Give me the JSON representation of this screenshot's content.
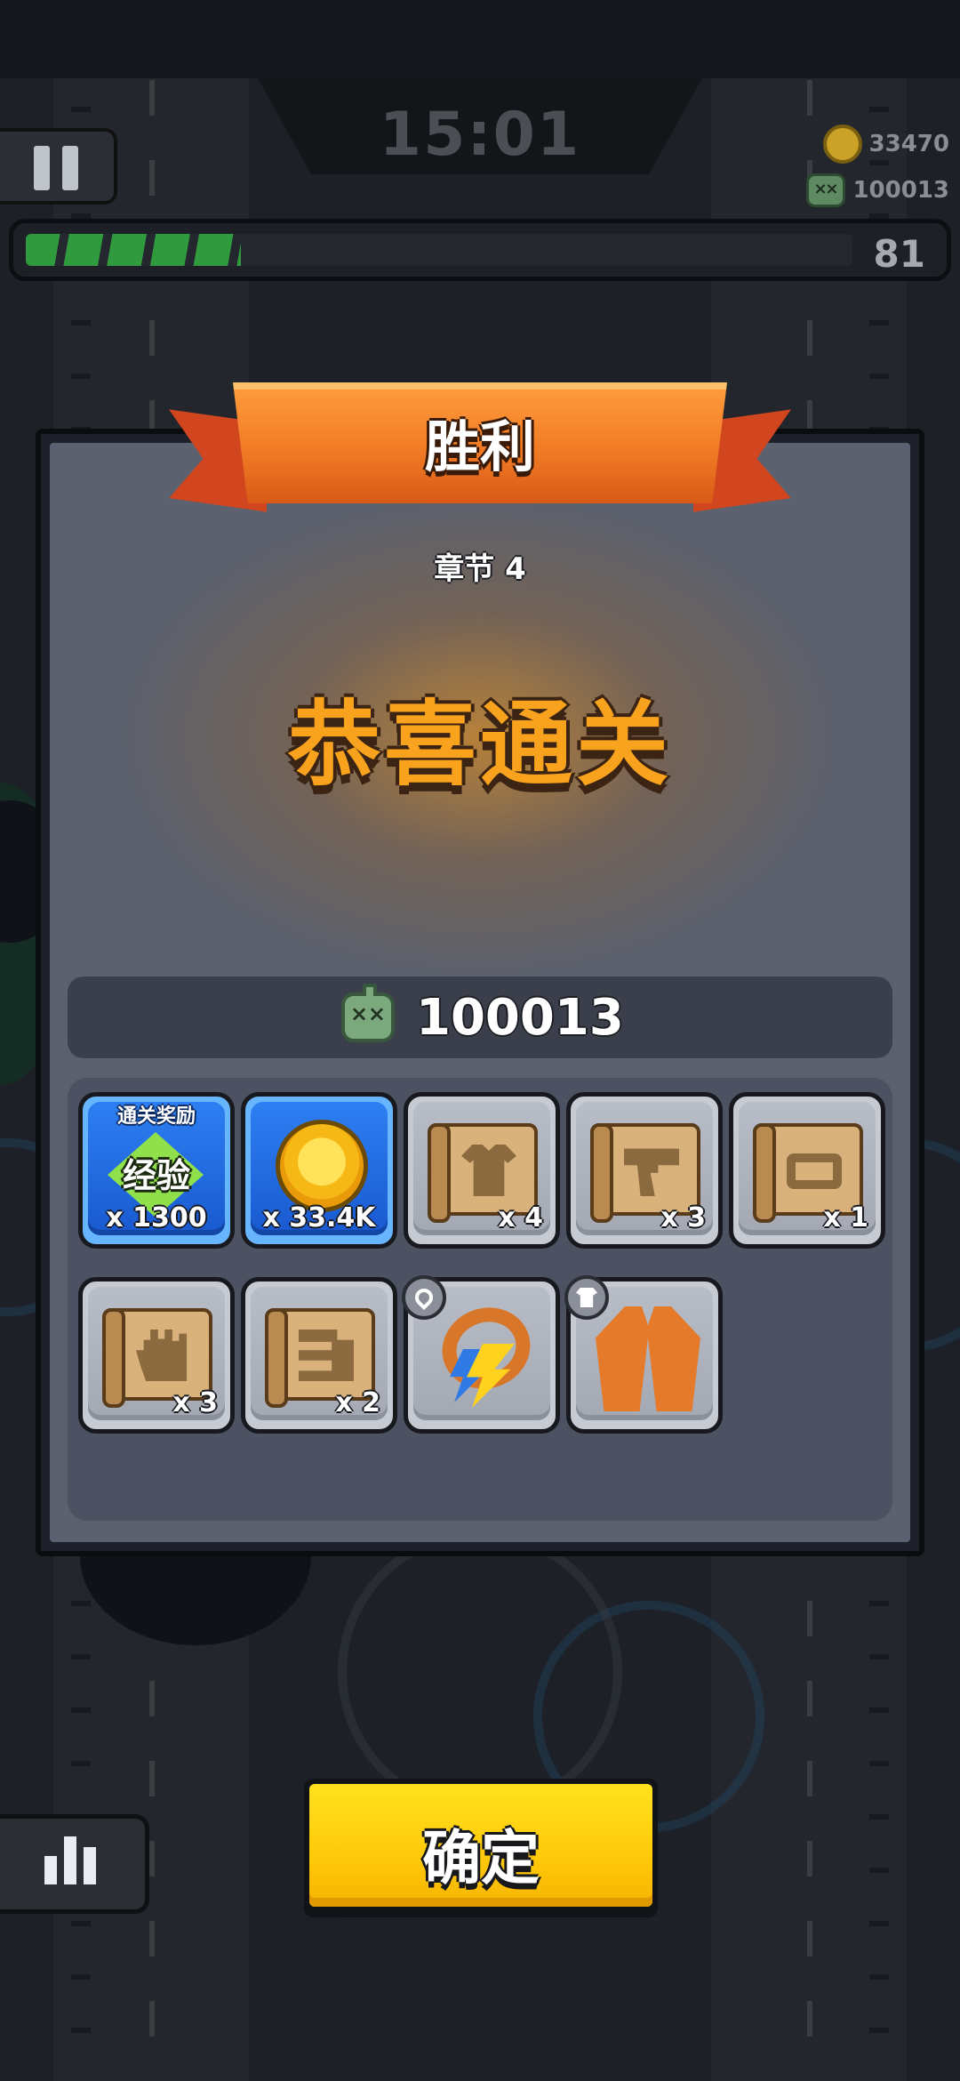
{
  "hud": {
    "timer": "15:01",
    "coins": "33470",
    "zombies": "100013",
    "progress_value": "81",
    "progress_fraction": 0.26
  },
  "panel": {
    "banner_title": "胜利",
    "chapter": "章节 4",
    "congrats": "恭喜通关",
    "score": "100013",
    "rewards_tag": "通关奖励",
    "rewards": [
      {
        "name": "exp",
        "label": "经验",
        "qty": "x 1300",
        "style": "blue"
      },
      {
        "name": "gold-coin",
        "qty": "x 33.4K",
        "style": "blue"
      },
      {
        "name": "armor-blueprint",
        "qty": "x 4",
        "style": "gray"
      },
      {
        "name": "weapon-blueprint",
        "qty": "x 3",
        "style": "gray"
      },
      {
        "name": "belt-blueprint",
        "qty": "x 1",
        "style": "gray"
      },
      {
        "name": "glove-blueprint",
        "qty": "x 3",
        "style": "gray"
      },
      {
        "name": "misc-blueprint",
        "qty": "x 2",
        "style": "gray"
      },
      {
        "name": "necklace-equipment",
        "qty": "",
        "style": "gray"
      },
      {
        "name": "jacket-equipment",
        "qty": "",
        "style": "gray"
      }
    ]
  },
  "buttons": {
    "confirm": "确定"
  },
  "colors": {
    "accent_orange": "#f07a24",
    "congrats_gold": "#f9a21d",
    "button_yellow": "#ffc90a",
    "tile_blue": "#1959d0",
    "progress_green": "#2f9a3e"
  }
}
